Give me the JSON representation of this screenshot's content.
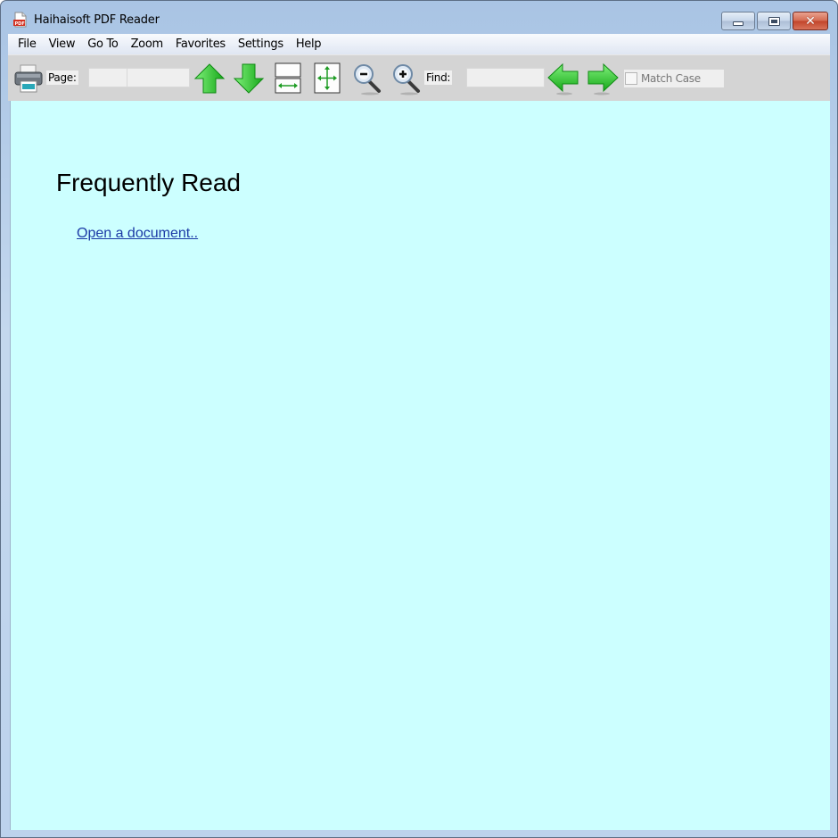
{
  "window": {
    "title": "Haihaisoft PDF Reader",
    "app_icon": "pdf-file-icon",
    "controls": {
      "minimize": "minimize-icon",
      "maximize": "maximize-icon",
      "close": "close-icon",
      "close_glyph": "✕"
    }
  },
  "menubar": {
    "items": [
      {
        "label": "File"
      },
      {
        "label": "View"
      },
      {
        "label": "Go To"
      },
      {
        "label": "Zoom"
      },
      {
        "label": "Favorites"
      },
      {
        "label": "Settings"
      },
      {
        "label": "Help"
      }
    ]
  },
  "toolbar": {
    "print_icon": "printer-icon",
    "page_label": "Page:",
    "page_input_value": "",
    "page_total_value": "",
    "prev_page_icon": "arrow-up-icon",
    "next_page_icon": "arrow-down-icon",
    "fit_width_icon": "fit-width-icon",
    "fit_page_icon": "fit-page-icon",
    "zoom_out_icon": "zoom-out-icon",
    "zoom_in_icon": "zoom-in-icon",
    "find_label": "Find:",
    "find_input_value": "",
    "find_prev_icon": "arrow-left-icon",
    "find_next_icon": "arrow-right-icon",
    "match_case_label": "Match Case",
    "match_case_checked": false
  },
  "content": {
    "heading": "Frequently Read",
    "open_link": "Open a document..",
    "background_color": "#ccffff",
    "link_color": "#1b3aa6"
  }
}
